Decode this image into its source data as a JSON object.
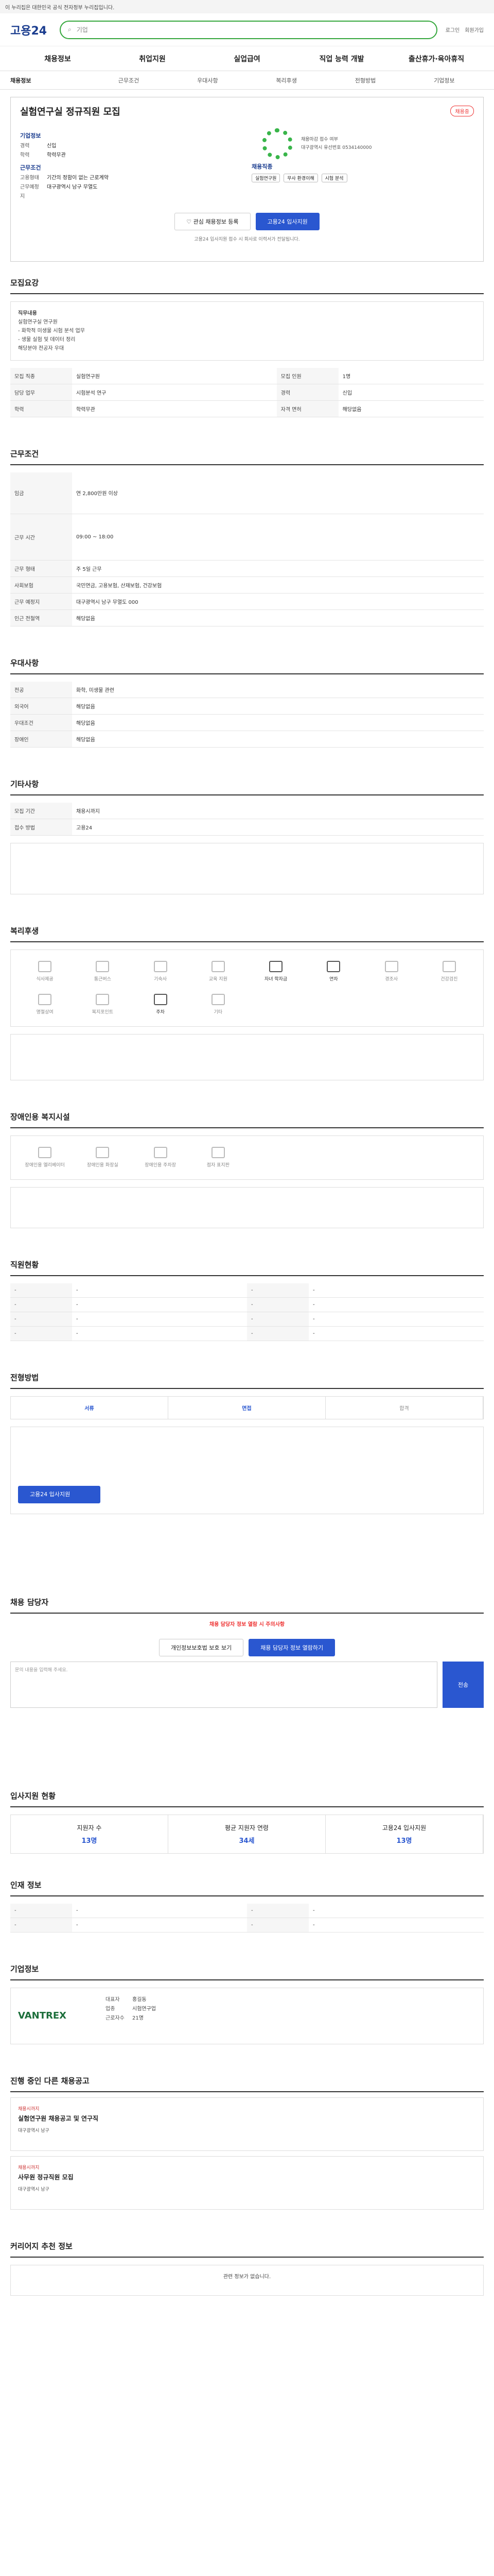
{
  "gov_banner": "이 누리집은 대한민국 공식 전자정부 누리집입니다.",
  "header": {
    "logo": "고용24",
    "search_placeholder": "기업",
    "util": [
      "로그인",
      "회원가입"
    ]
  },
  "gnb": [
    "채용정보",
    "취업지원",
    "실업급여",
    "직업 능력 개발",
    "출산휴가·육아휴직"
  ],
  "lnb": [
    "채용정보",
    "근무조건",
    "우대사항",
    "복리후생",
    "전형방법",
    "기업정보"
  ],
  "summary": {
    "title": "실험연구실 정규직원 모집",
    "badge": "채용중",
    "company_label": "기업정보",
    "company": [
      [
        "경력",
        "신입"
      ],
      [
        "학력",
        "학력무관"
      ]
    ],
    "work_label": "근무조건",
    "work": [
      [
        "고용형태",
        "기간의 정함이 없는 근로계약"
      ],
      [
        "근무예정지",
        "대구광역시 남구 무열도"
      ]
    ],
    "job_label": "채용직종",
    "chips": [
      "실험연구원",
      "무사 환경이해",
      "시험 분석"
    ],
    "deadline": "채용마감 접수 여부",
    "deadline_note": "대구광역시 유선번호 0534140000",
    "apply": "고용24 입사지원",
    "interest": "관심 채용정보 등록",
    "note": "고용24 입사지원 접수 시 회사로 이력서가 전달됩니다."
  },
  "sections": {
    "recruit": "모집요강",
    "work": "근무조건",
    "pref": "우대사항",
    "etc": "기타사항",
    "welfare": "복리후생",
    "disabled": "장애인용 복지시설",
    "company": "직원현황",
    "process": "전형방법",
    "contact": "채용 담당자",
    "status": "입사지원 현황",
    "info": "인재 정보",
    "corp": "기업정보",
    "other": "진행 중인 다른 채용공고",
    "note": "커리어지 추천 정보"
  },
  "recruit_box": [
    "직무내용",
    "실험연구실 연구원",
    "- 화학적 미생물 시험 분석 업무",
    "- 생물 실험 및 데이터 정리",
    "해당분야 전공자 우대"
  ],
  "recruit_table": [
    [
      "모집 직종",
      "실험연구원"
    ],
    [
      "모집 인원",
      "1명"
    ],
    [
      "담당 업무",
      "시험분석 연구"
    ],
    [
      "경력",
      "신입"
    ],
    [
      "학력",
      "학력무관"
    ],
    [
      "자격 면허",
      "해당없음"
    ]
  ],
  "work_table": [
    [
      "임금",
      "연 2,800만원 이상"
    ],
    [
      "근무 시간",
      "09:00 ~ 18:00"
    ],
    [
      "근무 형태",
      "주 5일 근무"
    ],
    [
      "사회보험",
      "국민연금, 고용보험, 산재보험, 건강보험"
    ],
    [
      "근무 예정지",
      "대구광역시 남구 무열도 000"
    ],
    [
      "인근 전철역",
      "해당없음"
    ]
  ],
  "pref_table": [
    [
      "전공",
      "화학, 미생물 관련"
    ],
    [
      "외국어",
      "해당없음"
    ],
    [
      "우대조건",
      "해당없음"
    ],
    [
      "장애인",
      "해당없음"
    ]
  ],
  "etc_table": [
    [
      "모집 기간",
      "채용시까지"
    ],
    [
      "접수 방법",
      "고용24"
    ]
  ],
  "welfare_items": [
    "식사제공",
    "통근버스",
    "기숙사",
    "교육 지원",
    "자녀 학자금",
    "연차",
    "경조사",
    "건강검진",
    "명절상여",
    "복지포인트",
    "주차",
    "기타"
  ],
  "welfare_on": [
    4,
    5,
    10
  ],
  "disabled_items": [
    "장애인용 엘리베이터",
    "장애인용 화장실",
    "장애인용 주차장",
    "점자 표지판"
  ],
  "process_tabs": [
    "서류",
    "면접",
    "합격"
  ],
  "apply_stat": [
    [
      "지원자 수",
      "13명"
    ],
    [
      "평균 지원자 연령",
      "34세"
    ],
    [
      "고용24 입사지원",
      "13명"
    ]
  ],
  "contact": {
    "warn": "채용 담당자 정보 열람 시 주의사항",
    "buttons": [
      "개인정보보호법 보호 보기",
      "채용 담당자 정보 열람하기"
    ],
    "send": "전송",
    "placeholder": "문의 내용을 입력해 주세요."
  },
  "corp": {
    "name": "VANTREX",
    "rows": [
      [
        "대표자",
        "홍길동"
      ],
      [
        "업종",
        "시험연구업"
      ],
      [
        "근로자수",
        "21명"
      ]
    ]
  },
  "jobs": [
    {
      "company": "채용시까지",
      "title": "실험연구원 채용공고 및 연구직",
      "desc": "대구광역시 남구"
    },
    {
      "company": "채용시까지",
      "title": "사무원 정규직원 모집",
      "desc": "대구광역시 남구"
    }
  ],
  "note_text": "관련 정보가 없습니다."
}
